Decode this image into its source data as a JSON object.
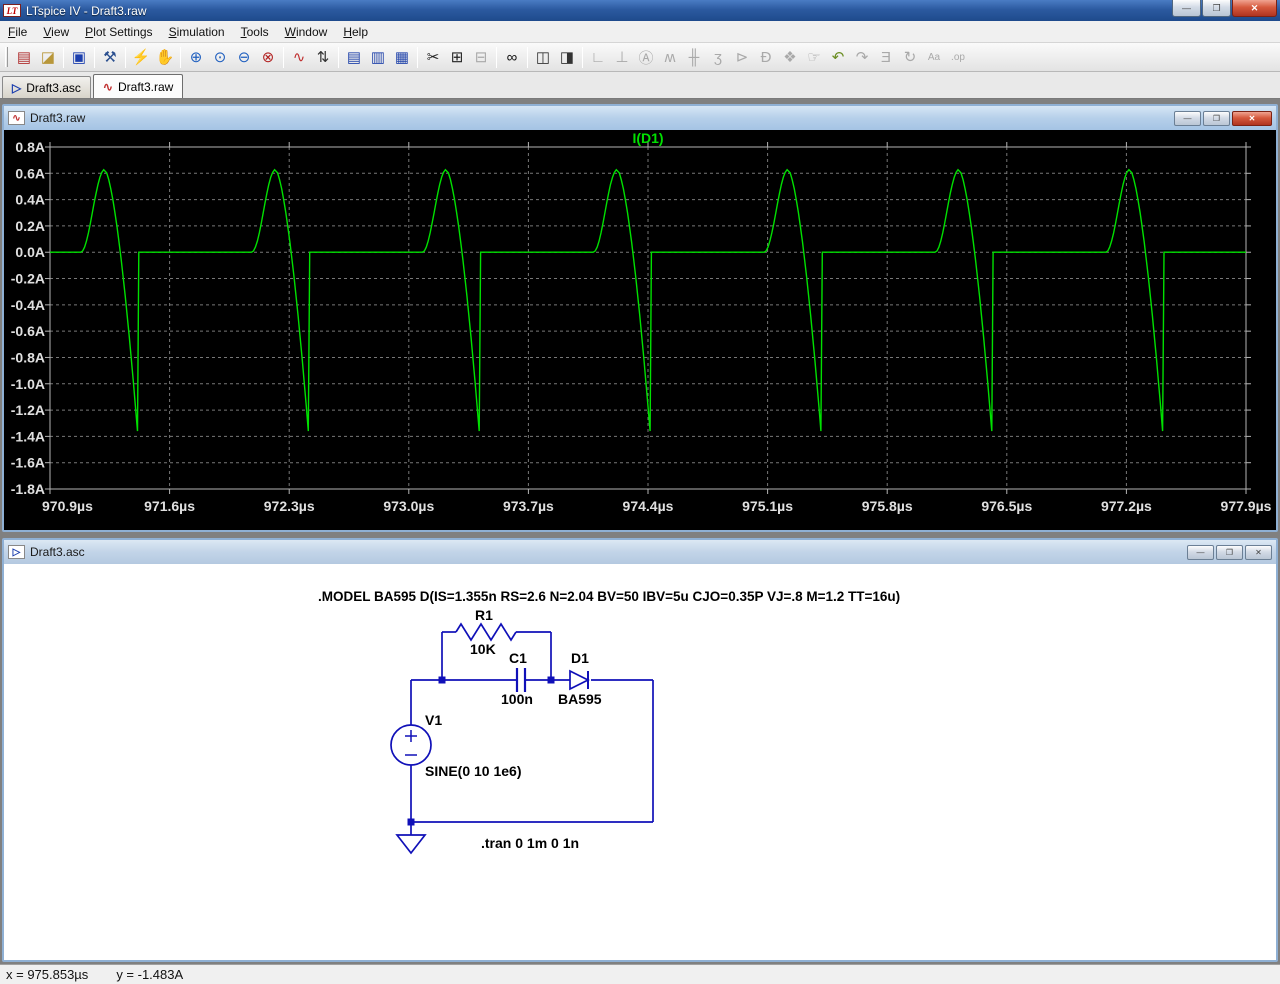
{
  "window": {
    "title": "LTspice IV - Draft3.raw",
    "logo_text": "LT",
    "buttons": {
      "minimize": "—",
      "restore": "❐",
      "close": "✕"
    }
  },
  "menu": {
    "items": [
      "File",
      "View",
      "Plot Settings",
      "Simulation",
      "Tools",
      "Window",
      "Help"
    ]
  },
  "toolbar": {
    "groups": [
      [
        {
          "name": "new-schematic-icon",
          "glyph": "▤",
          "color": "#b03030",
          "enabled": true
        },
        {
          "name": "open-icon",
          "glyph": "◪",
          "color": "#b8973a",
          "enabled": true
        }
      ],
      [
        {
          "name": "save-icon",
          "glyph": "▣",
          "color": "#1c3fae",
          "enabled": true
        }
      ],
      [
        {
          "name": "control-panel-icon",
          "glyph": "⚒",
          "color": "#2a4f8f",
          "enabled": true
        }
      ],
      [
        {
          "name": "run-icon",
          "glyph": "⚡",
          "color": "#333333",
          "enabled": true
        },
        {
          "name": "halt-icon",
          "glyph": "✋",
          "color": "#a9a9a9",
          "enabled": false
        }
      ],
      [
        {
          "name": "zoom-in-icon",
          "glyph": "⊕",
          "color": "#1f5fbf",
          "enabled": true
        },
        {
          "name": "zoom-back-icon",
          "glyph": "⊙",
          "color": "#1f5fbf",
          "enabled": true
        },
        {
          "name": "zoom-out-icon",
          "glyph": "⊖",
          "color": "#1f5fbf",
          "enabled": true
        },
        {
          "name": "zoom-full-extents-icon",
          "glyph": "⊗",
          "color": "#b22222",
          "enabled": true
        }
      ],
      [
        {
          "name": "plot-settings-icon",
          "glyph": "∿",
          "color": "#c03030",
          "enabled": true
        },
        {
          "name": "autorange-y-axis-icon",
          "glyph": "⇅",
          "color": "#333333",
          "enabled": true
        }
      ],
      [
        {
          "name": "tile-windows-icon",
          "glyph": "▤",
          "color": "#2244aa",
          "enabled": true
        },
        {
          "name": "cascade-windows-icon",
          "glyph": "▥",
          "color": "#2244aa",
          "enabled": true
        },
        {
          "name": "arrange-windows-icon",
          "glyph": "▦",
          "color": "#2244aa",
          "enabled": true
        }
      ],
      [
        {
          "name": "cut-icon",
          "glyph": "✂",
          "color": "#222222",
          "enabled": true
        },
        {
          "name": "copy-icon",
          "glyph": "⊞",
          "color": "#222222",
          "enabled": true
        },
        {
          "name": "paste-icon",
          "glyph": "⊟",
          "color": "#aaaaaa",
          "enabled": false
        }
      ],
      [
        {
          "name": "find-icon",
          "glyph": "∞",
          "color": "#111111",
          "enabled": true
        }
      ],
      [
        {
          "name": "print-preview-icon",
          "glyph": "◫",
          "color": "#333333",
          "enabled": true
        },
        {
          "name": "print-icon",
          "glyph": "◨",
          "color": "#333333",
          "enabled": true
        }
      ],
      [
        {
          "name": "wire-icon",
          "glyph": "∟",
          "enabled": false
        },
        {
          "name": "ground-icon",
          "glyph": "⊥",
          "enabled": false
        },
        {
          "name": "net-label-icon",
          "glyph": "Ⓐ",
          "enabled": false
        },
        {
          "name": "resistor-icon",
          "glyph": "ʍ",
          "enabled": false
        },
        {
          "name": "capacitor-icon",
          "glyph": "╫",
          "enabled": false
        },
        {
          "name": "inductor-icon",
          "glyph": "ʒ",
          "enabled": false
        },
        {
          "name": "diode-icon",
          "glyph": "⊳",
          "enabled": false
        },
        {
          "name": "component-icon",
          "glyph": "Ð",
          "enabled": false
        },
        {
          "name": "move-icon",
          "glyph": "❖",
          "enabled": false
        },
        {
          "name": "drag-icon",
          "glyph": "☞",
          "enabled": false
        },
        {
          "name": "undo-icon",
          "glyph": "↶",
          "color": "#6b8e23",
          "enabled": true
        },
        {
          "name": "redo-icon",
          "glyph": "↷",
          "enabled": false
        },
        {
          "name": "mirror-icon",
          "glyph": "Ǝ",
          "enabled": false
        },
        {
          "name": "rotate-icon",
          "glyph": "↻",
          "enabled": false
        },
        {
          "name": "text-icon",
          "glyph": "Aa",
          "enabled": false
        },
        {
          "name": "spice-directive-icon",
          "glyph": ".op",
          "enabled": false
        }
      ]
    ]
  },
  "tabs": [
    {
      "label": "Draft3.asc",
      "icon_name": "schematic-file-icon",
      "icon_glyph": "▷",
      "icon_color": "#1c3fae",
      "active": false
    },
    {
      "label": "Draft3.raw",
      "icon_name": "waveform-file-icon",
      "icon_glyph": "∿",
      "icon_color": "#c03030",
      "active": true
    }
  ],
  "plot_window": {
    "title": "Draft3.raw",
    "icon_glyph": "∿",
    "icon_color": "#c03030",
    "buttons": {
      "minimize": "—",
      "restore": "❐",
      "close": "✕"
    },
    "chart_data": {
      "type": "line",
      "title": "I(D1)",
      "trace_label": "I(D1)",
      "trace_color": "#00e000",
      "background": "#000000",
      "grid": true,
      "x_ticks": [
        "970.9µs",
        "971.6µs",
        "972.3µs",
        "973.0µs",
        "973.7µs",
        "974.4µs",
        "975.1µs",
        "975.8µs",
        "976.5µs",
        "977.2µs",
        "977.9µs"
      ],
      "x_range_us": [
        970.9,
        977.9
      ],
      "y_ticks": [
        "0.8A",
        "0.6A",
        "0.4A",
        "0.2A",
        "0.0A",
        "-0.2A",
        "-0.4A",
        "-0.6A",
        "-0.8A",
        "-1.0A",
        "-1.2A",
        "-1.4A",
        "-1.6A",
        "-1.8A"
      ],
      "y_range_a": [
        -1.8,
        0.8
      ],
      "waveform": {
        "shape": "periodic positive hump then sharp negative spike with instant reset to zero",
        "baseline_a": 0.0,
        "period_us": 1.0,
        "first_peak_us": 971.22,
        "peak_a": 0.63,
        "min_a": -1.49,
        "rise_us": 0.14,
        "fall_us": 0.2,
        "num_periods": 7
      }
    }
  },
  "schematic_window": {
    "title": "Draft3.asc",
    "icon_glyph": "▷",
    "icon_color": "#1c3fae",
    "buttons": {
      "minimize": "—",
      "restore": "❐",
      "close": "✕"
    },
    "wire_color": "#1010b8",
    "model_directive": ".MODEL BA595 D(IS=1.355n RS=2.6 N=2.04 BV=50 IBV=5u CJO=0.35P VJ=.8 M=1.2 TT=16u)",
    "tran_directive": ".tran 0 1m 0 1n",
    "components": [
      {
        "ref": "R1",
        "value": "10K"
      },
      {
        "ref": "C1",
        "value": "100n"
      },
      {
        "ref": "D1",
        "value": "BA595"
      },
      {
        "ref": "V1",
        "value": "SINE(0 10 1e6)"
      }
    ]
  },
  "status_bar": {
    "x_readout": "x = 975.853µs",
    "y_readout": "y = -1.483A"
  }
}
